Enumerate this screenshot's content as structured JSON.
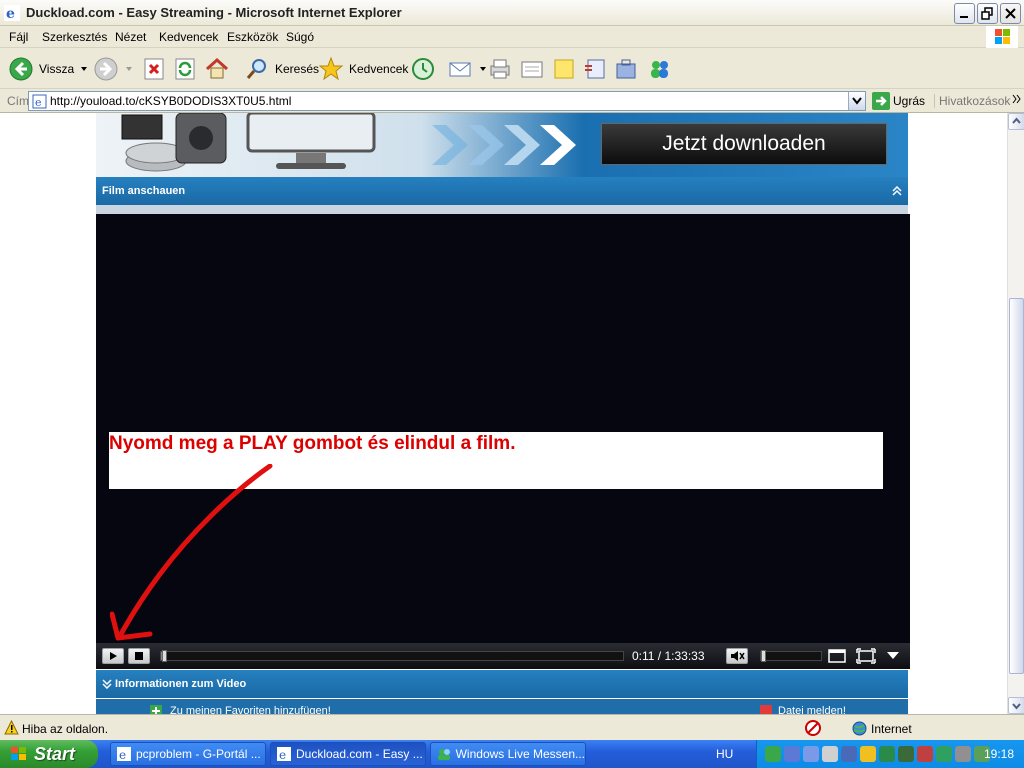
{
  "window": {
    "title": "Duckload.com - Easy Streaming - Microsoft Internet Explorer"
  },
  "menu": [
    "Fájl",
    "Szerkesztés",
    "Nézet",
    "Kedvencek",
    "Eszközök",
    "Súgó"
  ],
  "toolbar": {
    "back_label": "Vissza",
    "search_label": "Keresés",
    "favorites_label": "Kedvencek"
  },
  "address": {
    "label": "Cím",
    "url": "http://youload.to/cKSYB0DODIS3XT0U5.html",
    "go_label": "Ugrás",
    "links_label": "Hivatkozások"
  },
  "page": {
    "download_button": "Jetzt downloaden",
    "watch_section": "Film anschauen",
    "overlay_message": "Nyomd meg a PLAY gombot és elindul a film.",
    "player_time": "0:11 / 1:33:33",
    "progress_fraction": 0.002,
    "volume_fraction": 0.0,
    "info_section": "Informationen zum Video",
    "add_favorites": "Zu meinen Favoriten hinzufügen!",
    "report_file": "Datei melden!"
  },
  "status": {
    "text": "Hiba az oldalon.",
    "zone": "Internet"
  },
  "taskbar": {
    "start_label": "Start",
    "tasks": [
      "pcproblem - G-Portál ...",
      "Duckload.com - Easy ...",
      "Windows Live Messen..."
    ],
    "language": "HU",
    "clock": "19:18"
  },
  "colors": {
    "section_blue": "#1f74b4",
    "message_red": "#dd0000",
    "player_bg": "#05060f"
  }
}
